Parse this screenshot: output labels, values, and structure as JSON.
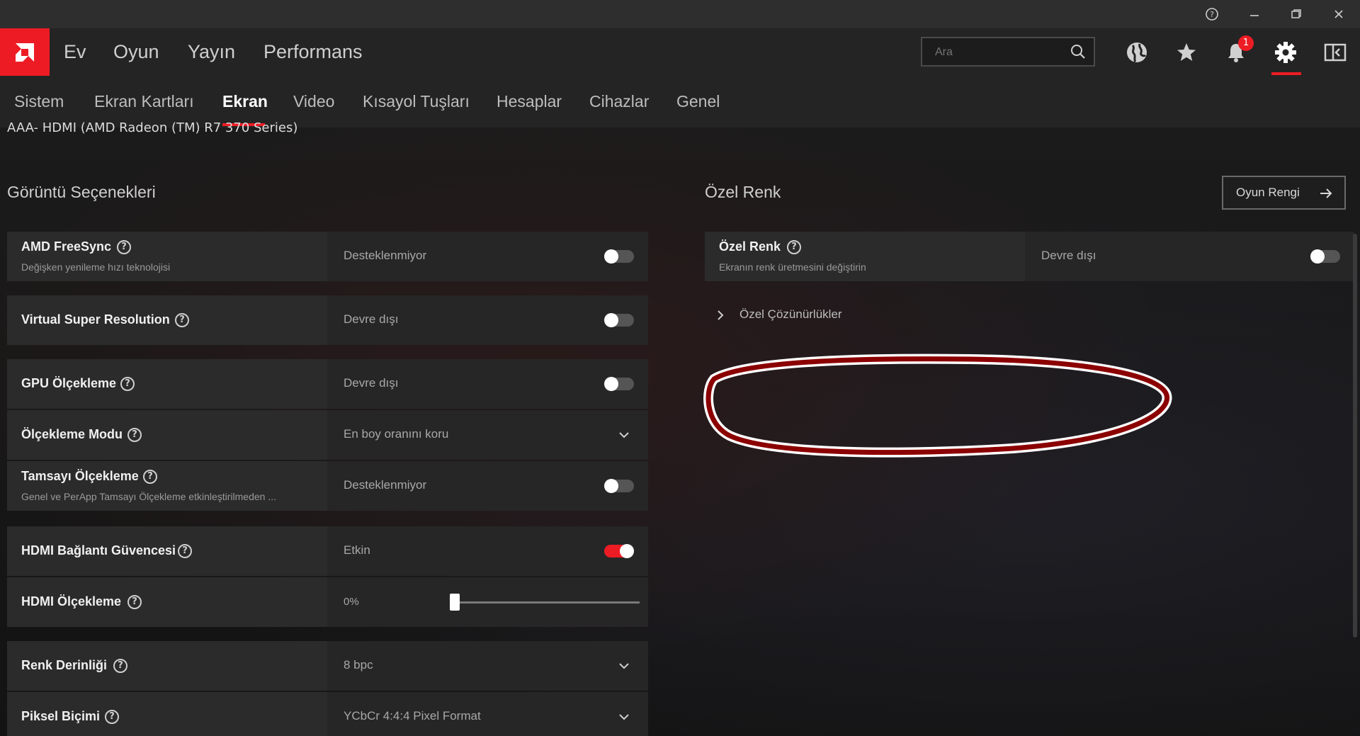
{
  "window": {
    "help_icon": "question-circle-icon",
    "minimize_icon": "minimize-icon",
    "restore_icon": "restore-icon",
    "close_icon": "close-icon"
  },
  "nav": {
    "logo": "AMD",
    "items": [
      "Ev",
      "Oyun",
      "Yayın",
      "Performans"
    ],
    "search_placeholder": "Ara",
    "notifications_count": "1",
    "icons": [
      "globe-icon",
      "star-icon",
      "bell-icon",
      "gear-icon",
      "sidebar-icon"
    ]
  },
  "subnav": {
    "items": [
      "Sistem",
      "Ekran Kartları",
      "Ekran",
      "Video",
      "Kısayol Tuşları",
      "Hesaplar",
      "Cihazlar",
      "Genel"
    ],
    "active": "Ekran"
  },
  "device": "AAA- HDMI (AMD Radeon (TM) R7 370 Series)",
  "left": {
    "title": "Görüntü Seçenekleri",
    "rows": [
      {
        "title": "AMD FreeSync",
        "subtitle": "Değişken yenileme hızı teknolojisi",
        "value": "Desteklenmiyor",
        "control": "toggle-off"
      },
      {
        "title": "Virtual Super Resolution",
        "value": "Devre dışı",
        "control": "toggle-off"
      },
      {
        "title": "GPU Ölçekleme",
        "value": "Devre dışı",
        "control": "toggle-off"
      },
      {
        "title": "Ölçekleme Modu",
        "value": "En boy oranını koru",
        "control": "dropdown"
      },
      {
        "title": "Tamsayı Ölçekleme",
        "subtitle": "Genel ve PerApp Tamsayı Ölçekleme etkinleştirilmeden ...",
        "value": "Desteklenmiyor",
        "control": "toggle-off"
      },
      {
        "title": "HDMI Bağlantı Güvencesi",
        "value": "Etkin",
        "control": "toggle-on"
      },
      {
        "title": "HDMI Ölçekleme",
        "value": "0%",
        "control": "slider",
        "slider_level": 0
      },
      {
        "title": "Renk Derinliği",
        "value": "8 bpc",
        "control": "dropdown"
      },
      {
        "title": "Piksel Biçimi",
        "value": "YCbCr 4:4:4 Pixel Format",
        "control": "dropdown"
      }
    ]
  },
  "right": {
    "title": "Özel Renk",
    "button": "Oyun Rengi",
    "row": {
      "title": "Özel Renk",
      "subtitle": "Ekranın renk üretmesini değiştirin",
      "value": "Devre dışı",
      "control": "toggle-off"
    },
    "expander": "Özel Çözünürlükler"
  },
  "colors": {
    "accent": "#ed1c24",
    "annotation": "#8b0000"
  }
}
